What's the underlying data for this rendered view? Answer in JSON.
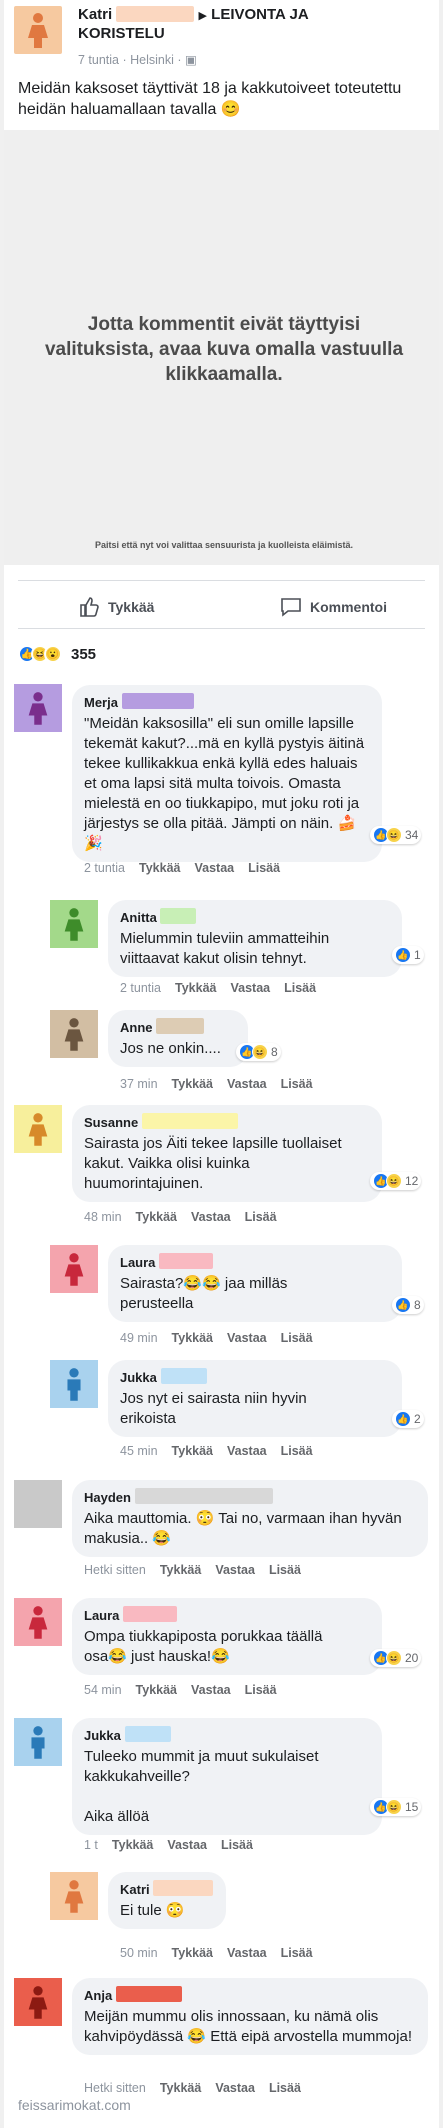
{
  "post": {
    "author": "Katri",
    "group": "LEIVONTA JA KORISTELU",
    "time": "7 tuntia",
    "location": "Helsinki",
    "text": "Meidän kaksoset täyttivät 18 ja kakkutoiveet toteutettu heidän haluamallaan tavalla 😊",
    "media_notice": "Jotta kommentit eivät täyttyisi valituksista, avaa kuva omalla vastuulla klikkaamalla.",
    "media_footnote": "Paitsi että nyt voi valittaa sensuurista ja kuolleista eläimistä.",
    "like_label": "Tykkää",
    "comment_label": "Kommentoi",
    "reaction_count": "355"
  },
  "labels": {
    "like": "Tykkää",
    "reply": "Vastaa",
    "more": "Lisää"
  },
  "comments": [
    {
      "name": "Merja",
      "text": "\"Meidän kaksosilla\" eli sun omille lapsille tekemät kakut?...mä en kyllä pystyis äitinä tekee kullikakkua enkä kyllä edes haluais et oma lapsi sitä multa toivois. Omasta mielestä en oo tiukkapipo, mut joku roti ja järjestys se olla pitää. Jämpti on näin. 🍰🎉",
      "time": "2 tuntia",
      "count": "34"
    },
    {
      "name": "Anitta",
      "text": "Mielummin tuleviin ammatteihin viittaavat kakut olisin tehnyt.",
      "time": "2 tuntia",
      "count": "1"
    },
    {
      "name": "Anne",
      "text": "Jos ne onkin....",
      "time": "37 min",
      "count": "8"
    },
    {
      "name": "Susanne",
      "text": "Sairasta jos Äiti tekee lapsille tuollaiset kakut. Vaikka olisi kuinka huumorintajuinen.",
      "time": "48 min",
      "count": "12"
    },
    {
      "name": "Laura",
      "text": "Sairasta?😂😂 jaa milläs perusteella",
      "time": "49 min",
      "count": "8"
    },
    {
      "name": "Jukka",
      "text": "Jos nyt ei sairasta niin hyvin erikoista",
      "time": "45 min",
      "count": "2"
    },
    {
      "name": "Hayden",
      "text": "Aika mauttomia. 😳 Tai no, varmaan ihan hyvän makusia.. 😂",
      "time": "Hetki sitten",
      "count": ""
    },
    {
      "name": "Laura",
      "text": "Ompa tiukkapiposta porukkaa täällä osa😂 just hauska!😂",
      "time": "54 min",
      "count": "20"
    },
    {
      "name": "Jukka",
      "text": "Tuleeko mummit ja muut sukulaiset kakkukahveille?",
      "text2": "Aika ällöä",
      "time": "1 t",
      "count": "15"
    },
    {
      "name": "Katri",
      "text": "Ei tule 😳",
      "time": "50 min",
      "count": ""
    },
    {
      "name": "Anja",
      "text": "Meijän mummu olis innossaan, ku nämä olis kahvipöydässä 😂 Että eipä arvostella mummoja!",
      "time": "Hetki sitten",
      "count": ""
    }
  ],
  "watermark": "feissarimokat.com",
  "colors": {
    "katri": "#f6c9a0",
    "merja": "#b59ce0",
    "anitta": "#a3d98a",
    "anne": "#d2bea3",
    "susanne": "#f7ef9c",
    "laura": "#f4a4ad",
    "jukka": "#a9d2ee",
    "hayden": "#c9c9c9",
    "anja": "#ea5e4c"
  }
}
